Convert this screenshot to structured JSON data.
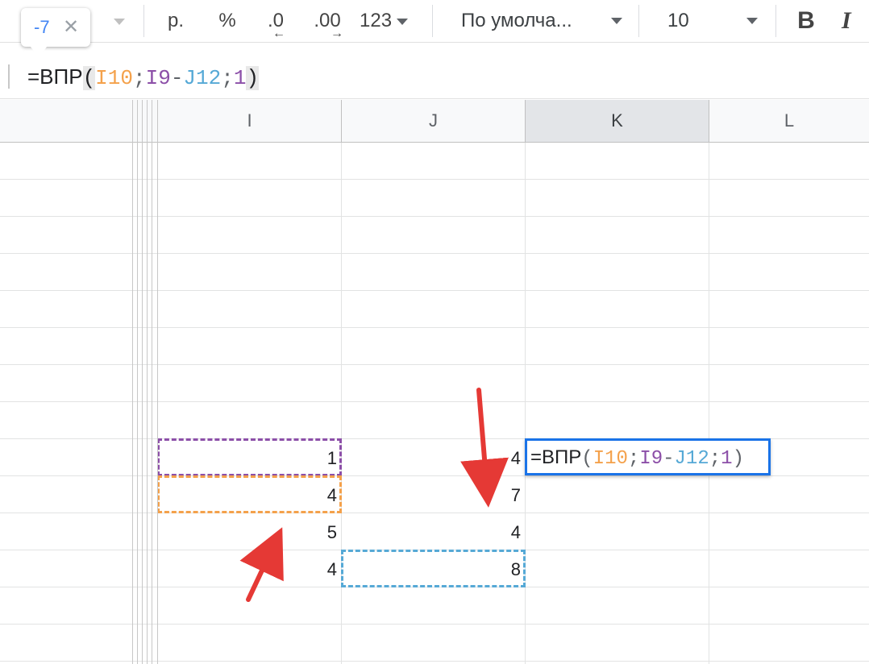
{
  "tooltip": {
    "value": "-7",
    "close": "✕"
  },
  "toolbar": {
    "currency": "р.",
    "percent": "%",
    "decrease_decimals": ".0",
    "increase_decimals": ".00",
    "format_more": "123",
    "font_name": "По умолча...",
    "font_size": "10",
    "bold": "B",
    "italic": "I"
  },
  "formula_bar": {
    "eq": "=ВПР",
    "open": "(",
    "arg1": "I10",
    "sep1": ";",
    "arg2a": "I9",
    "minus": "-",
    "arg2b": "J12",
    "sep2": ";",
    "arg3": "1",
    "close": ")"
  },
  "columns": [
    "I",
    "J",
    "K",
    "L"
  ],
  "active_column": "K",
  "cells": {
    "i9": "1",
    "i10": "4",
    "i11": "5",
    "i12": "4",
    "j9": "4",
    "j10": "7",
    "j11": "4",
    "j12": "8"
  },
  "editor": {
    "eq": "=ВПР",
    "open": "(",
    "arg1": "I10",
    "sep1": ";",
    "arg2a": "I9",
    "minus": "-",
    "arg2b": "J12",
    "sep2": ";",
    "arg3": "1",
    "close": ")"
  },
  "colors": {
    "ref_i9": "#8c4fa8",
    "ref_i10": "#f4a14b",
    "ref_j12": "#56a9d6",
    "editor_border": "#1a73e8",
    "annotation_arrow": "#e53935"
  }
}
